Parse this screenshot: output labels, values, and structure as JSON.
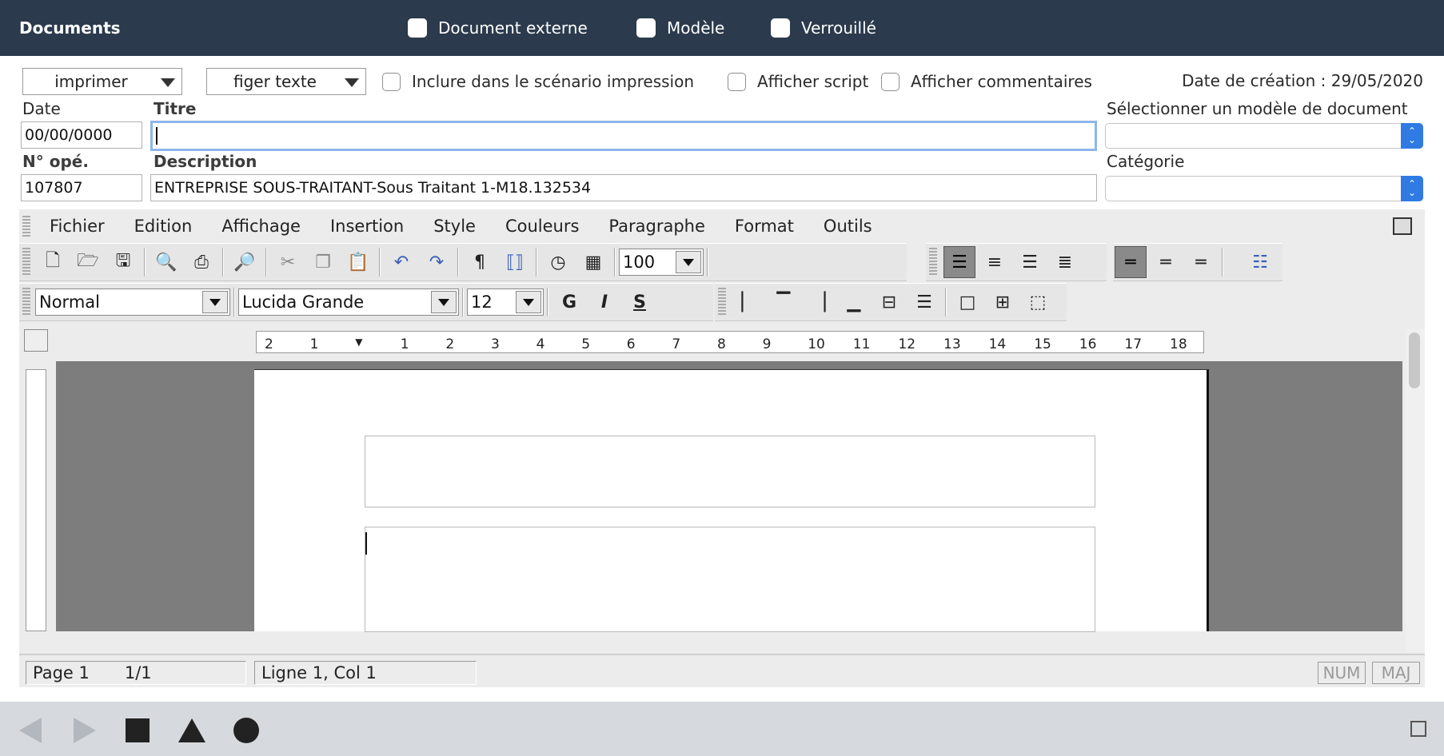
{
  "header": {
    "title": "Documents",
    "checkboxes": [
      "Document externe",
      "Modèle",
      "Verrouillé"
    ]
  },
  "toolbar_row": {
    "print_combo": "imprimer",
    "freeze_combo": "figer texte",
    "include_label": "Inclure dans le scénario impression",
    "show_script_label": "Afficher script",
    "show_comments_label": "Afficher commentaires",
    "creation_date": "Date de création : 29/05/2020"
  },
  "form": {
    "date_label": "Date",
    "date_value": "00/00/0000",
    "title_label": "Titre",
    "title_value": "",
    "template_label": "Sélectionner un modèle de document",
    "op_label": "N° opé.",
    "op_value": "107807",
    "description_label": "Description",
    "description_value": "ENTREPRISE SOUS-TRAITANT-Sous Traitant 1-M18.132534",
    "category_label": "Catégorie"
  },
  "editor": {
    "menu": [
      "Fichier",
      "Edition",
      "Affichage",
      "Insertion",
      "Style",
      "Couleurs",
      "Paragraphe",
      "Format",
      "Outils"
    ],
    "zoom": "100",
    "style": "Normal",
    "font": "Lucida Grande",
    "size": "12",
    "bold": "G",
    "italic": "I",
    "underline": "S",
    "ruler_ticks": [
      "2",
      "1",
      "",
      "1",
      "2",
      "3",
      "4",
      "5",
      "6",
      "7",
      "8",
      "9",
      "10",
      "11",
      "12",
      "13",
      "14",
      "15",
      "16",
      "17",
      "18"
    ]
  },
  "status": {
    "page": "Page 1",
    "pages": "1/1",
    "position": "Ligne 1, Col 1",
    "num": "NUM",
    "maj": "MAJ"
  }
}
